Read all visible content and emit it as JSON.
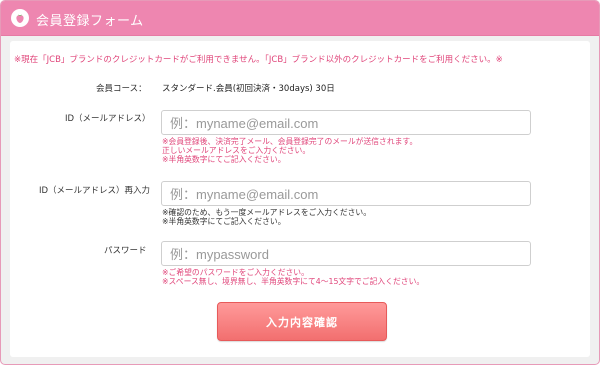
{
  "header": {
    "title": "会員登録フォーム",
    "icon": "strawberry-icon"
  },
  "notice": "※現在「JCB」ブランドのクレジットカードがご利用できません。「JCB」ブランド以外のクレジットカードをご利用ください。※",
  "course": {
    "label": "会員コース：",
    "value": "スタンダード.会員(初回決済・30days) 30日"
  },
  "email": {
    "label": "ID（メールアドレス）",
    "placeholder": "例：myname@email.com",
    "notes": [
      "※会員登録後、決済完了メール、会員登録完了のメールが送信されます。",
      "正しいメールアドレスをご入力ください。",
      "※半角英数字にてご記入ください。"
    ]
  },
  "email_confirm": {
    "label": "ID（メールアドレス）再入力",
    "placeholder": "例：myname@email.com",
    "notes": [
      "※確認のため、もう一度メールアドレスをご入力ください。",
      "※半角英数字にてご記入ください。"
    ]
  },
  "password": {
    "label": "パスワード",
    "placeholder": "例：mypassword",
    "notes": [
      "※ご希望のパスワードをご入力ください。",
      "※スペース無し、境界無し、半角英数字にて4～15文字でご記入ください。"
    ]
  },
  "submit_label": "入力内容確認",
  "colors": {
    "header": "#ee86b0",
    "accent_text": "#e0457a",
    "button": "#f26f6f"
  }
}
